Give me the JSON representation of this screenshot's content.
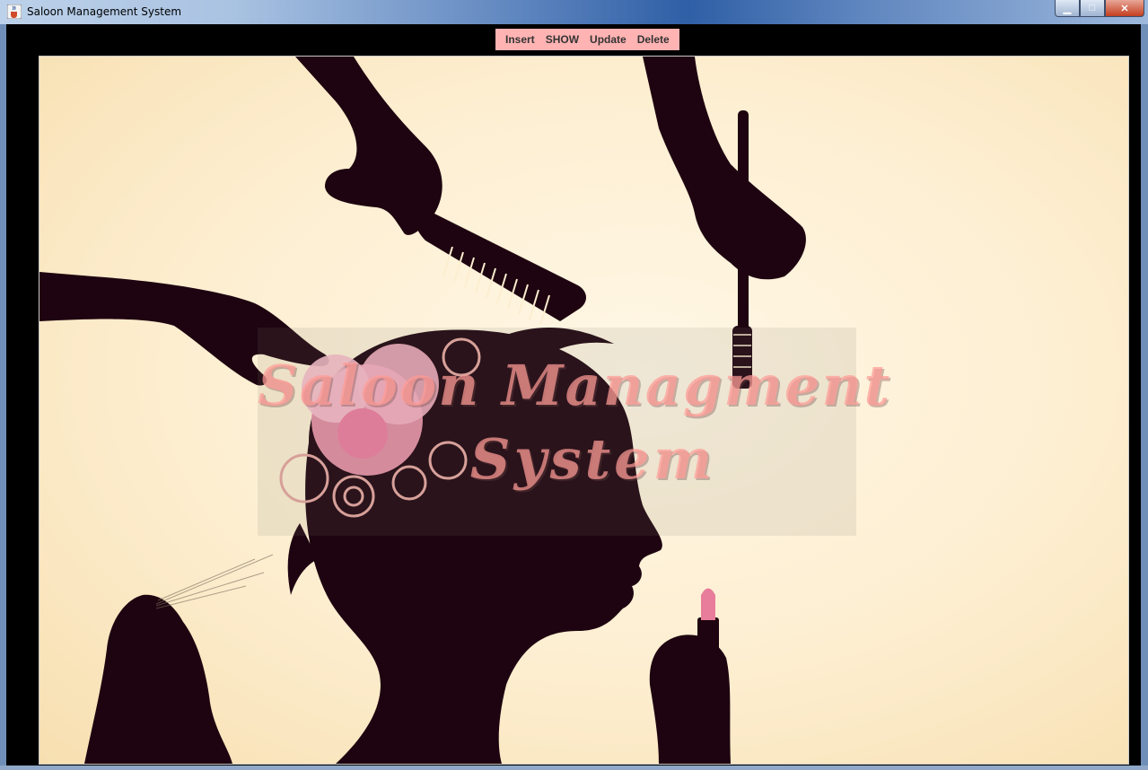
{
  "window": {
    "title": "Saloon Management System",
    "controls": [
      "minimize",
      "maximize",
      "close"
    ]
  },
  "menu": {
    "items": [
      {
        "id": "insert",
        "label": "Insert"
      },
      {
        "id": "show",
        "label": "SHOW"
      },
      {
        "id": "update",
        "label": "Update"
      },
      {
        "id": "delete",
        "label": "Delete"
      }
    ],
    "background": "#ffb3b3"
  },
  "banner": {
    "line1": "Saloon Managment",
    "line2": "System"
  },
  "colors": {
    "silhouette": "#1e0410",
    "background_cream": "#fdeed0",
    "flower_pink": "#f39bb2",
    "title_pink": "#ff9b96"
  },
  "icons": {
    "app": "java-cup-icon",
    "minimize": "minimize-icon",
    "maximize": "maximize-icon",
    "close": "close-icon"
  }
}
